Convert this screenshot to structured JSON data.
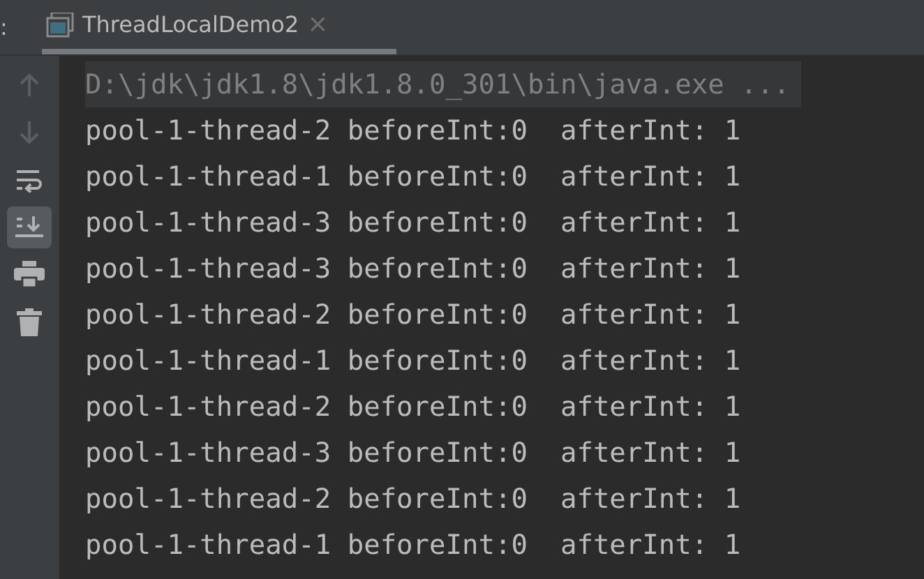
{
  "tab_bar": {
    "edge_mark": ":",
    "tabs": [
      {
        "label": "ThreadLocalDemo2",
        "selected": true,
        "close": "×"
      }
    ]
  },
  "toolbar": [
    {
      "kind": "up",
      "disabled": true,
      "selected": false
    },
    {
      "kind": "down",
      "disabled": true,
      "selected": false
    },
    {
      "kind": "wrap",
      "disabled": false,
      "selected": false
    },
    {
      "kind": "scrollend",
      "disabled": false,
      "selected": true
    },
    {
      "kind": "print",
      "disabled": false,
      "selected": false
    },
    {
      "kind": "trash",
      "disabled": false,
      "selected": false
    }
  ],
  "console": {
    "command": "D:\\jdk\\jdk1.8\\jdk1.8.0_301\\bin\\java.exe ...",
    "lines": [
      "pool-1-thread-2 beforeInt:0  afterInt: 1",
      "pool-1-thread-1 beforeInt:0  afterInt: 1",
      "pool-1-thread-3 beforeInt:0  afterInt: 1",
      "pool-1-thread-3 beforeInt:0  afterInt: 1",
      "pool-1-thread-2 beforeInt:0  afterInt: 1",
      "pool-1-thread-1 beforeInt:0  afterInt: 1",
      "pool-1-thread-2 beforeInt:0  afterInt: 1",
      "pool-1-thread-3 beforeInt:0  afterInt: 1",
      "pool-1-thread-2 beforeInt:0  afterInt: 1",
      "pool-1-thread-1 beforeInt:0  afterInt: 1"
    ]
  }
}
